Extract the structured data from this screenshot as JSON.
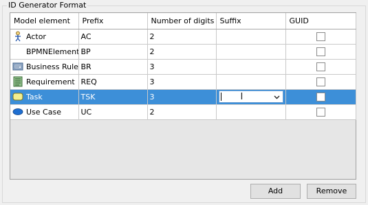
{
  "group": {
    "title": "ID Generator Format"
  },
  "table": {
    "headers": [
      "Model element",
      "Prefix",
      "Number of digits",
      "Suffix",
      "GUID"
    ],
    "rows": [
      {
        "icon": "actor-icon",
        "name": "Actor",
        "prefix": "AC",
        "digits": "2",
        "suffix": "",
        "guid": false
      },
      {
        "icon": "",
        "name": "BPMNElement",
        "prefix": "BP",
        "digits": "2",
        "suffix": "",
        "guid": false
      },
      {
        "icon": "business-rule-icon",
        "name": "Business Rule",
        "prefix": "BR",
        "digits": "3",
        "suffix": "",
        "guid": false
      },
      {
        "icon": "requirement-icon",
        "name": "Requirement",
        "prefix": "REQ",
        "digits": "3",
        "suffix": "",
        "guid": false
      },
      {
        "icon": "task-icon",
        "name": "Task",
        "prefix": "TSK",
        "digits": "3",
        "suffix": "",
        "guid": false,
        "selected": true
      },
      {
        "icon": "use-case-icon",
        "name": "Use Case",
        "prefix": "UC",
        "digits": "2",
        "suffix": "",
        "guid": false
      }
    ]
  },
  "buttons": {
    "add": "Add",
    "remove": "Remove"
  },
  "colors": {
    "selection": "#3d8fd8",
    "task_icon": "#f3ef8f",
    "use_case_icon": "#1f6fd1"
  }
}
